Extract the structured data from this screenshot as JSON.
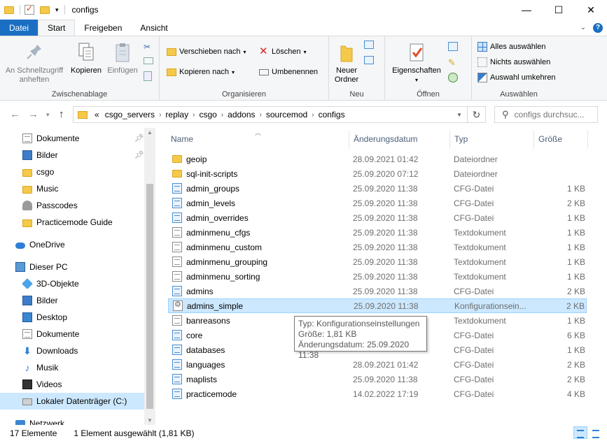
{
  "window": {
    "title": "configs",
    "controls": {
      "minimize": "—",
      "maximize": "☐",
      "close": "✕"
    }
  },
  "ribbon_tabs": [
    "Datei",
    "Start",
    "Freigeben",
    "Ansicht"
  ],
  "ribbon": {
    "clipboard": {
      "label": "Zwischenablage",
      "pin": "An Schnellzugriff\nanheften",
      "copy": "Kopieren",
      "paste": "Einfügen"
    },
    "organize": {
      "label": "Organisieren",
      "move_to": "Verschieben nach",
      "copy_to": "Kopieren nach",
      "delete": "Löschen",
      "rename": "Umbenennen"
    },
    "new": {
      "label": "Neu",
      "new_folder": "Neuer\nOrdner"
    },
    "open": {
      "label": "Öffnen",
      "properties": "Eigenschaften"
    },
    "select": {
      "label": "Auswählen",
      "select_all": "Alles auswählen",
      "select_none": "Nichts auswählen",
      "invert": "Auswahl umkehren"
    }
  },
  "address": {
    "overflow": "«",
    "crumbs": [
      "csgo_servers",
      "replay",
      "csgo",
      "addons",
      "sourcemod",
      "configs"
    ],
    "search_placeholder": "configs durchsuc..."
  },
  "sidebar": {
    "items": [
      {
        "label": "Dokumente",
        "icon": "document-icon",
        "pinned": true
      },
      {
        "label": "Bilder",
        "icon": "pictures-icon",
        "pinned": true
      },
      {
        "label": "csgo",
        "icon": "folder-icon"
      },
      {
        "label": "Music",
        "icon": "folder-icon"
      },
      {
        "label": "Passcodes",
        "icon": "lock-icon"
      },
      {
        "label": "Practicemode Guide",
        "icon": "folder-icon"
      },
      {
        "label": "OneDrive",
        "icon": "cloud-icon"
      },
      {
        "label": "Dieser PC",
        "icon": "pc-icon"
      },
      {
        "label": "3D-Objekte",
        "icon": "3d-objects-icon"
      },
      {
        "label": "Bilder",
        "icon": "pictures-icon"
      },
      {
        "label": "Desktop",
        "icon": "desktop-icon"
      },
      {
        "label": "Dokumente",
        "icon": "document-icon"
      },
      {
        "label": "Downloads",
        "icon": "download-icon"
      },
      {
        "label": "Musik",
        "icon": "music-icon"
      },
      {
        "label": "Videos",
        "icon": "video-icon"
      },
      {
        "label": "Lokaler Datenträger (C:)",
        "icon": "drive-icon"
      },
      {
        "label": "Netzwerk",
        "icon": "network-icon"
      }
    ]
  },
  "columns": {
    "name": "Name",
    "date": "Änderungsdatum",
    "type": "Typ",
    "size": "Größe"
  },
  "files": [
    {
      "name": "geoip",
      "date": "28.09.2021 01:42",
      "type": "Dateiordner",
      "size": "",
      "kind": "folder"
    },
    {
      "name": "sql-init-scripts",
      "date": "25.09.2020 07:12",
      "type": "Dateiordner",
      "size": "",
      "kind": "folder"
    },
    {
      "name": "admin_groups",
      "date": "25.09.2020 11:38",
      "type": "CFG-Datei",
      "size": "1 KB",
      "kind": "cfg"
    },
    {
      "name": "admin_levels",
      "date": "25.09.2020 11:38",
      "type": "CFG-Datei",
      "size": "2 KB",
      "kind": "cfg"
    },
    {
      "name": "admin_overrides",
      "date": "25.09.2020 11:38",
      "type": "CFG-Datei",
      "size": "1 KB",
      "kind": "cfg"
    },
    {
      "name": "adminmenu_cfgs",
      "date": "25.09.2020 11:38",
      "type": "Textdokument",
      "size": "1 KB",
      "kind": "txt"
    },
    {
      "name": "adminmenu_custom",
      "date": "25.09.2020 11:38",
      "type": "Textdokument",
      "size": "1 KB",
      "kind": "txt"
    },
    {
      "name": "adminmenu_grouping",
      "date": "25.09.2020 11:38",
      "type": "Textdokument",
      "size": "1 KB",
      "kind": "txt"
    },
    {
      "name": "adminmenu_sorting",
      "date": "25.09.2020 11:38",
      "type": "Textdokument",
      "size": "1 KB",
      "kind": "txt"
    },
    {
      "name": "admins",
      "date": "25.09.2020 11:38",
      "type": "CFG-Datei",
      "size": "2 KB",
      "kind": "cfg"
    },
    {
      "name": "admins_simple",
      "date": "25.09.2020 11:38",
      "type": "Konfigurationsein...",
      "size": "2 KB",
      "kind": "ini",
      "selected": true
    },
    {
      "name": "banreasons",
      "date": "",
      "type": "Textdokument",
      "size": "1 KB",
      "kind": "txt"
    },
    {
      "name": "core",
      "date": "",
      "type": "CFG-Datei",
      "size": "6 KB",
      "kind": "cfg"
    },
    {
      "name": "databases",
      "date": "",
      "type": "CFG-Datei",
      "size": "1 KB",
      "kind": "cfg"
    },
    {
      "name": "languages",
      "date": "28.09.2021 01:42",
      "type": "CFG-Datei",
      "size": "2 KB",
      "kind": "cfg"
    },
    {
      "name": "maplists",
      "date": "25.09.2020 11:38",
      "type": "CFG-Datei",
      "size": "2 KB",
      "kind": "cfg"
    },
    {
      "name": "practicemode",
      "date": "14.02.2022 17:19",
      "type": "CFG-Datei",
      "size": "4 KB",
      "kind": "cfg"
    }
  ],
  "tooltip": {
    "line1": "Typ: Konfigurationseinstellungen",
    "line2": "Größe: 1,81 KB",
    "line3": "Änderungsdatum: 25.09.2020 11:38"
  },
  "status": {
    "count": "17 Elemente",
    "selection": "1 Element ausgewählt (1,81 KB)"
  }
}
